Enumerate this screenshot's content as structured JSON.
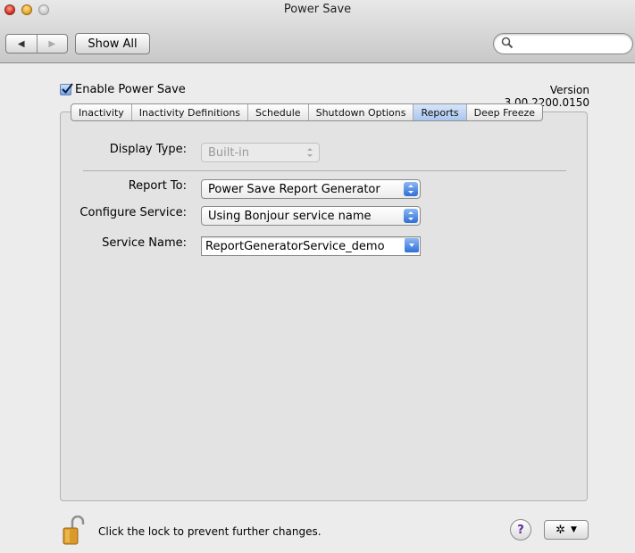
{
  "window": {
    "title": "Power Save"
  },
  "toolbar": {
    "back_label": "◀",
    "forward_label": "▶",
    "show_all_label": "Show All",
    "search_placeholder": ""
  },
  "enable": {
    "label": "Enable Power Save",
    "checked": true
  },
  "version": "Version 3.00.2200.0150",
  "tabs": [
    {
      "label": "Inactivity",
      "active": false
    },
    {
      "label": "Inactivity Definitions",
      "active": false
    },
    {
      "label": "Schedule",
      "active": false
    },
    {
      "label": "Shutdown Options",
      "active": false
    },
    {
      "label": "Reports",
      "active": true
    },
    {
      "label": "Deep Freeze",
      "active": false
    }
  ],
  "form": {
    "display_type": {
      "label": "Display Type:",
      "value": "Built-in"
    },
    "report_to": {
      "label": "Report To:",
      "value": "Power Save Report Generator"
    },
    "configure_service": {
      "label": "Configure Service:",
      "value": "Using Bonjour service name"
    },
    "service_name": {
      "label": "Service Name:",
      "value": "ReportGeneratorService_demo"
    }
  },
  "footer": {
    "lock_text": "Click the lock to prevent further changes.",
    "help_label": "?"
  },
  "colors": {
    "accent": "#3a7be0",
    "active_tab": "#b3cdf0",
    "background": "#ececec"
  }
}
